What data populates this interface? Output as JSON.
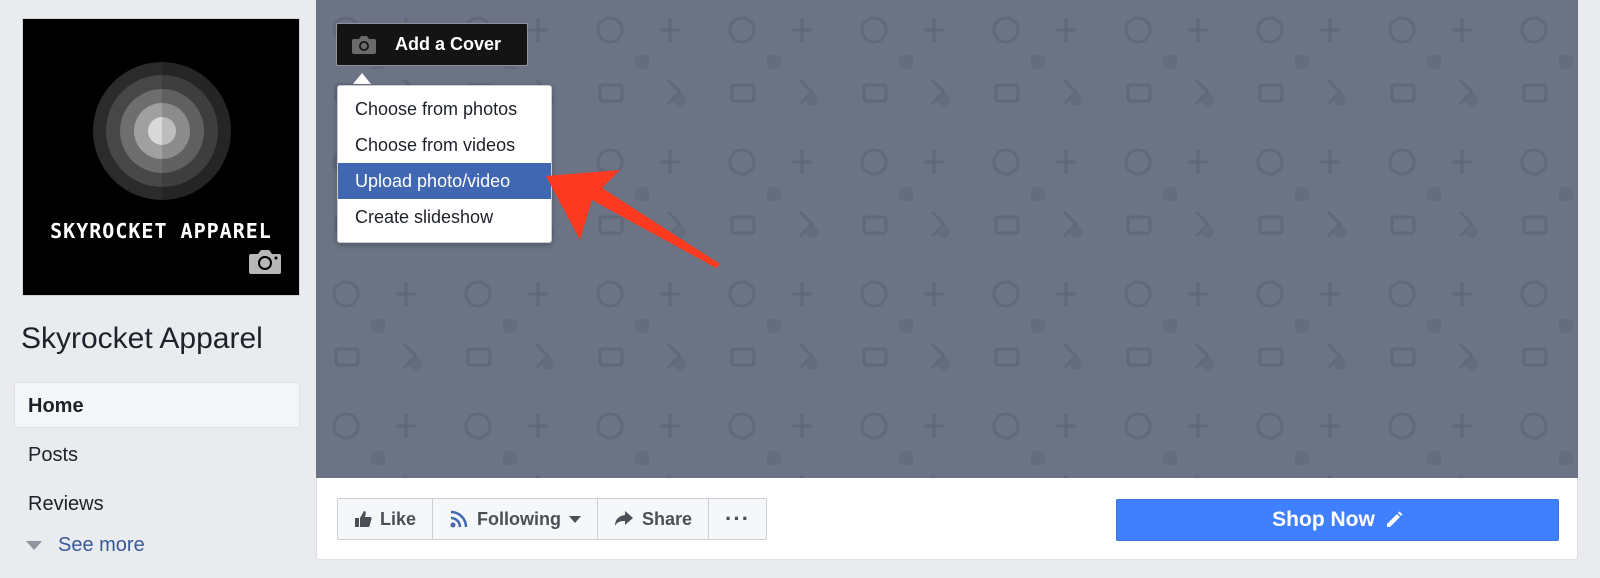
{
  "profile": {
    "logo_text": "SKYROCKET APPAREL",
    "page_name": "Skyrocket Apparel"
  },
  "nav": {
    "items": [
      {
        "label": "Home",
        "active": true
      },
      {
        "label": "Posts",
        "active": false
      },
      {
        "label": "Reviews",
        "active": false
      }
    ],
    "see_more": "See more"
  },
  "cover": {
    "add_cover_label": "Add a Cover",
    "menu": [
      {
        "label": "Choose from photos",
        "highlighted": false
      },
      {
        "label": "Choose from videos",
        "highlighted": false
      },
      {
        "label": "Upload photo/video",
        "highlighted": true
      },
      {
        "label": "Create slideshow",
        "highlighted": false
      }
    ]
  },
  "actions": {
    "like": "Like",
    "following": "Following",
    "share": "Share",
    "more": "···",
    "shop_now": "Shop Now"
  },
  "colors": {
    "cover_bg": "#6b7384",
    "menu_highlight": "#4267b2",
    "cta": "#4080ff",
    "annotation_arrow": "#fb3a1f",
    "link": "#365899"
  },
  "icons": {
    "profile_camera": "camera-icon",
    "add_cover": "camera-icon",
    "like": "thumbs-up-icon",
    "following": "rss-icon",
    "share": "share-arrow-icon",
    "shop_now": "pencil-icon",
    "see_more": "triangle-down-icon"
  }
}
